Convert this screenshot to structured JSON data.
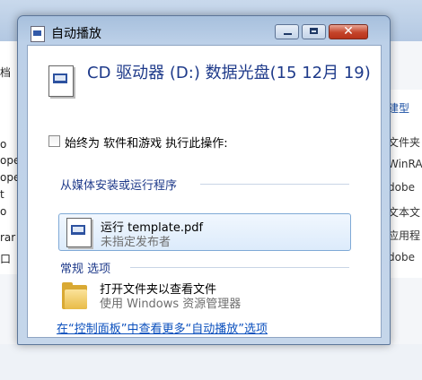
{
  "background": {
    "left_rows": [
      "档",
      "o",
      "ope",
      "ope",
      "t",
      "o",
      "rar",
      "口"
    ],
    "right_rows": [
      "建型",
      "",
      "文件夹",
      "WinRA",
      "dobe",
      "文本文",
      "应用程",
      "dobe"
    ]
  },
  "dialog": {
    "title": "自动播放",
    "heading": "CD 驱动器 (D:) 数据光盘(15 12月 19)",
    "always_label": "始终为 软件和游戏 执行此操作:",
    "group_install_title": "从媒体安装或运行程序",
    "run_item": {
      "label": "运行 template.pdf",
      "publisher": "未指定发布者"
    },
    "group_general_title": "常规 选项",
    "open_folder": {
      "label": "打开文件夹以查看文件",
      "subtitle": "使用 Windows 资源管理器"
    },
    "control_panel_link": "在“控制面板”中查看更多“自动播放”选项"
  },
  "icons": [
    "disc-icon",
    "folder-icon",
    "pdf-icon",
    "minimize-icon",
    "maximize-icon",
    "close-icon"
  ],
  "colors": {
    "link": "#0a4fbd",
    "heading": "#1e3a8a",
    "close_button": "#c4442a"
  }
}
